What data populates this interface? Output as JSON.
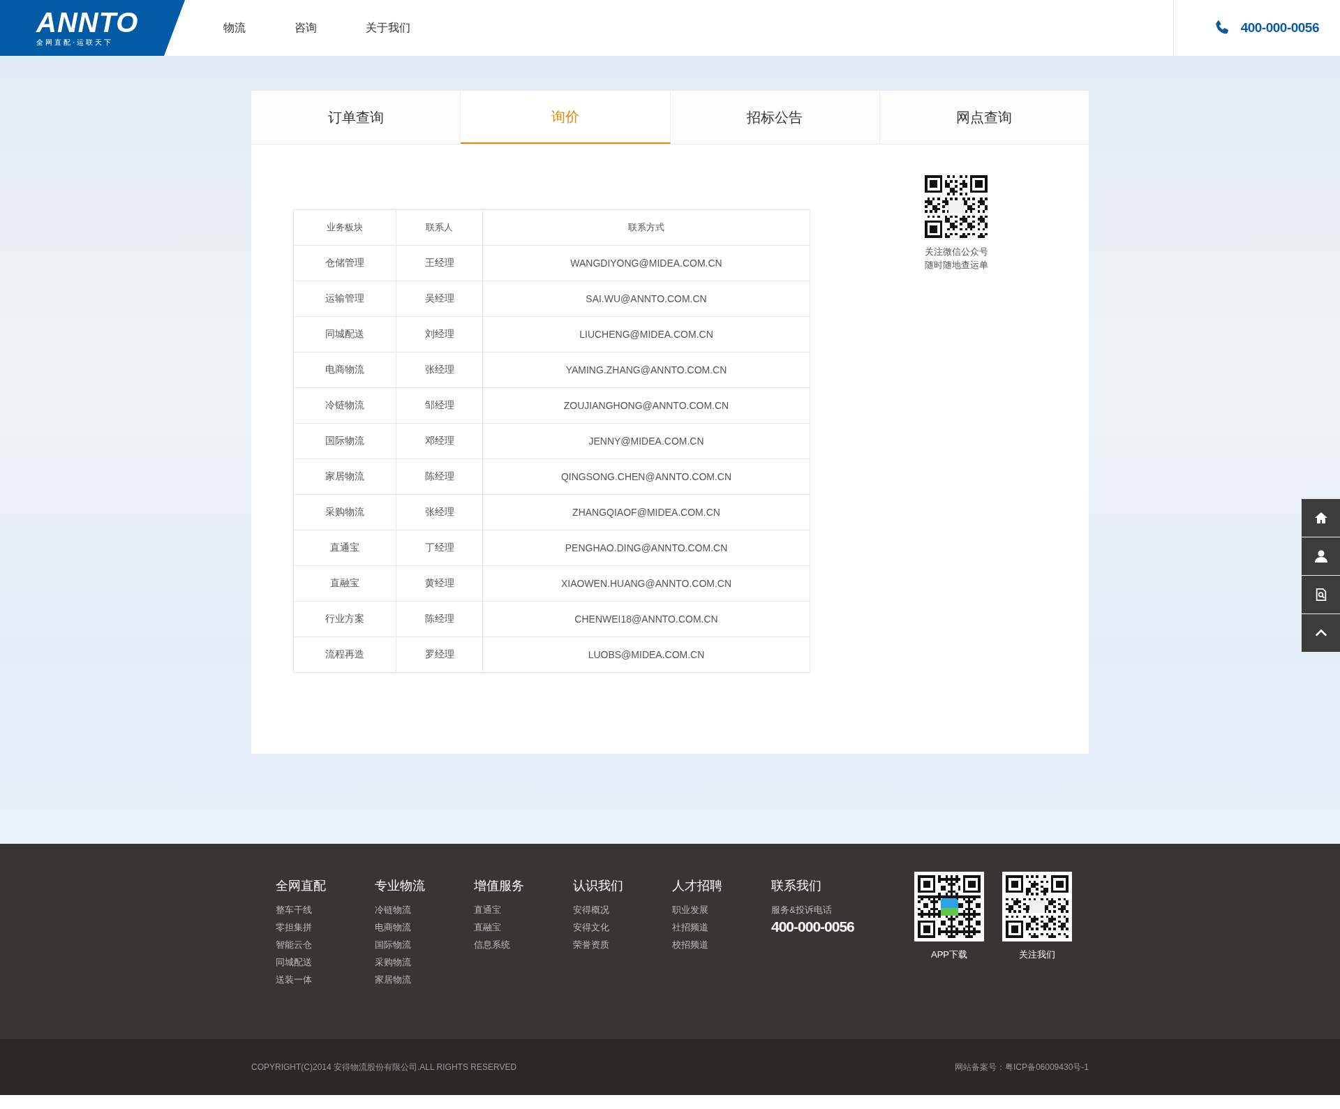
{
  "header": {
    "logo": {
      "name": "ANNTO",
      "slogan": "全网直配·运联天下"
    },
    "nav": [
      {
        "label": "物流"
      },
      {
        "label": "咨询"
      },
      {
        "label": "关于我们"
      }
    ],
    "phone": "400-000-0056"
  },
  "tabs": [
    {
      "label": "订单查询",
      "selected": false
    },
    {
      "label": "询价",
      "selected": true
    },
    {
      "label": "招标公告",
      "selected": false
    },
    {
      "label": "网点查询",
      "selected": false
    }
  ],
  "table": {
    "columns": [
      "业务板块",
      "联系人",
      "联系方式"
    ],
    "rows": [
      [
        "仓储管理",
        "王经理",
        "WANGDIYONG@MIDEA.COM.CN"
      ],
      [
        "运输管理",
        "吴经理",
        "SAI.WU@ANNTO.COM.CN"
      ],
      [
        "同城配送",
        "刘经理",
        "LIUCHENG@MIDEA.COM.CN"
      ],
      [
        "电商物流",
        "张经理",
        "YAMING.ZHANG@ANNTO.COM.CN"
      ],
      [
        "冷链物流",
        "邹经理",
        "ZOUJIANGHONG@ANNTO.COM.CN"
      ],
      [
        "国际物流",
        "邓经理",
        "JENNY@MIDEA.COM.CN"
      ],
      [
        "家居物流",
        "陈经理",
        "QINGSONG.CHEN@ANNTO.COM.CN"
      ],
      [
        "采购物流",
        "张经理",
        "ZHANGQIAOF@MIDEA.COM.CN"
      ],
      [
        "直通宝",
        "丁经理",
        "PENGHAO.DING@ANNTO.COM.CN"
      ],
      [
        "直融宝",
        "黄经理",
        "XIAOWEN.HUANG@ANNTO.COM.CN"
      ],
      [
        "行业方案",
        "陈经理",
        "CHENWEI18@ANNTO.COM.CN"
      ],
      [
        "流程再造",
        "罗经理",
        "LUOBS@MIDEA.COM.CN"
      ]
    ]
  },
  "qr": {
    "caption": [
      "关注微信公众号",
      "随时随地查运单"
    ]
  },
  "side_toolbar": [
    {
      "kind": "home"
    },
    {
      "kind": "user"
    },
    {
      "kind": "search"
    },
    {
      "kind": "top"
    }
  ],
  "footer": {
    "columns": [
      {
        "title": "全网直配",
        "links": [
          "整车干线",
          "零担集拼",
          "智能云仓",
          "同城配送",
          "送装一体"
        ]
      },
      {
        "title": "专业物流",
        "links": [
          "冷链物流",
          "电商物流",
          "国际物流",
          "采购物流",
          "家居物流"
        ]
      },
      {
        "title": "增值服务",
        "links": [
          "直通宝",
          "直融宝",
          "信息系统"
        ]
      },
      {
        "title": "认识我们",
        "links": [
          "安得概况",
          "安得文化",
          "荣誉资质"
        ]
      },
      {
        "title": "人才招聘",
        "links": [
          "职业发展",
          "社招频道",
          "校招频道"
        ]
      }
    ],
    "contact": {
      "title": "联系我们",
      "label": "服务&投诉电话",
      "phone": "400-000-0056"
    },
    "qrcodes": [
      {
        "caption": "APP下载",
        "kind": "app"
      },
      {
        "caption": "关注我们",
        "kind": "logo"
      }
    ],
    "copyright": "COPYRIGHT(C)2014 安得物流股份有限公司.ALL RIGHTS RESERVED",
    "icp": "网站备案号：粤ICP备06009430号-1"
  }
}
